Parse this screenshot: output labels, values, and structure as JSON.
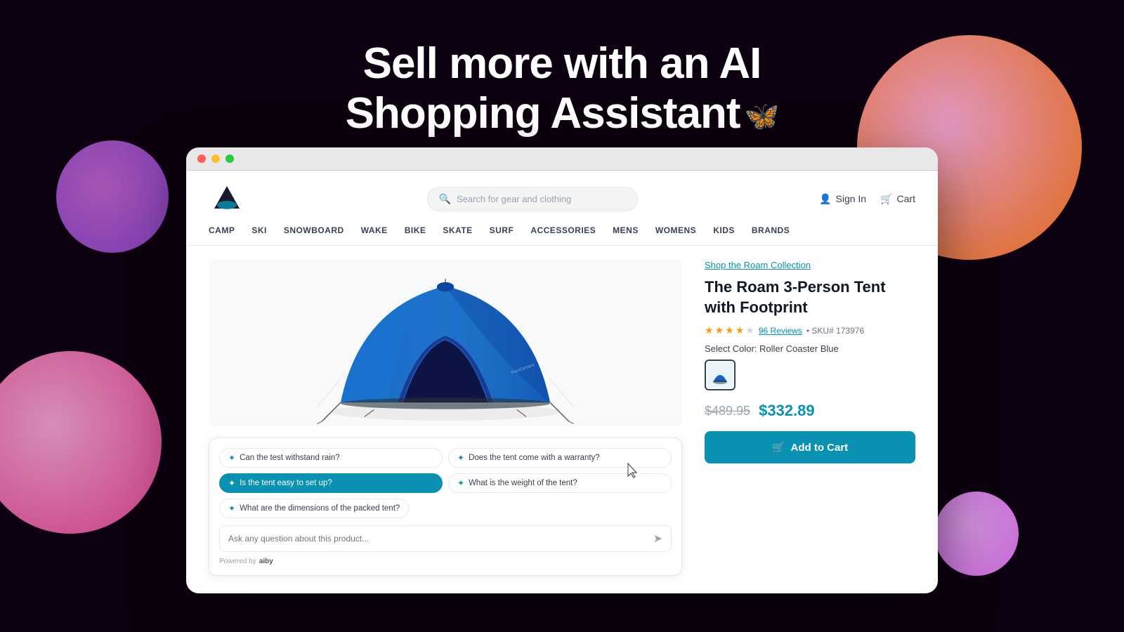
{
  "hero": {
    "line1": "Sell more with an AI",
    "line2": "Shopping Assistant"
  },
  "browser": {
    "store": {
      "search_placeholder": "Search for gear and clothing",
      "nav_items": [
        "CAMP",
        "SKI",
        "SNOWBOARD",
        "WAKE",
        "BIKE",
        "SKATE",
        "SURF",
        "ACCESSORIES",
        "MENS",
        "WOMENS",
        "KIDS",
        "BRANDS"
      ],
      "sign_in": "Sign In",
      "cart": "Cart",
      "collection_link": "Shop the Roam Collection",
      "product_title": "The Roam 3-Person Tent with Footprint",
      "reviews_count": "96 Reviews",
      "sku": "SKU# 173976",
      "color_label": "Select Color: Roller Coaster Blue",
      "original_price": "$489.95",
      "sale_price": "$332.89",
      "add_to_cart": "Add to Cart"
    },
    "ai_widget": {
      "questions": [
        "Can the test withstand rain?",
        "Does the tent come with a warranty?",
        "Is the tent easy to set up?",
        "What is the weight of the tent?",
        "What are the dimensions of the packed tent?"
      ],
      "input_placeholder": "Ask any question about this product...",
      "powered_by": "Powered by",
      "brand": "aiby"
    }
  }
}
